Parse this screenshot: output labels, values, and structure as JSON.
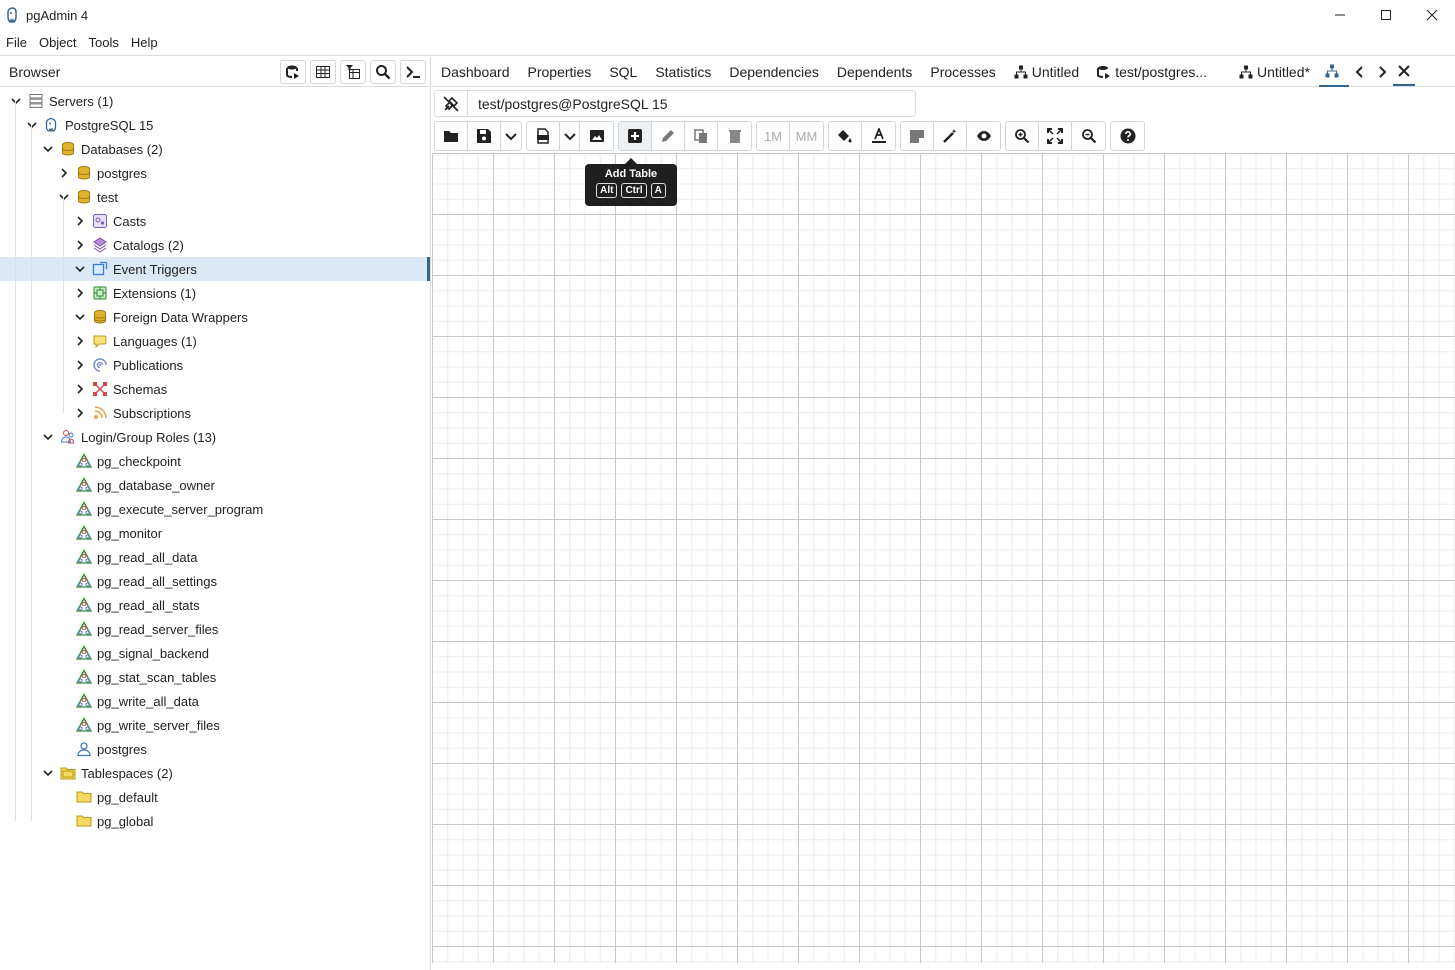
{
  "window": {
    "title": "pgAdmin 4"
  },
  "menu": [
    "File",
    "Object",
    "Tools",
    "Help"
  ],
  "browser": {
    "label": "Browser",
    "tree": [
      {
        "label": "Servers (1)",
        "level": 0,
        "chevron": "down",
        "icon": "servers-icon"
      },
      {
        "label": "PostgreSQL 15",
        "level": 1,
        "chevron": "down",
        "icon": "postgresql-icon"
      },
      {
        "label": "Databases (2)",
        "level": 2,
        "chevron": "down",
        "icon": "databases-icon"
      },
      {
        "label": "postgres",
        "level": 3,
        "chevron": "right",
        "icon": "database-icon"
      },
      {
        "label": "test",
        "level": 3,
        "chevron": "down",
        "icon": "database-icon"
      },
      {
        "label": "Casts",
        "level": 4,
        "chevron": "right",
        "icon": "casts-icon"
      },
      {
        "label": "Catalogs (2)",
        "level": 4,
        "chevron": "right",
        "icon": "catalogs-icon"
      },
      {
        "label": "Event Triggers",
        "level": 4,
        "chevron": "down",
        "icon": "event-triggers-icon",
        "selected": true
      },
      {
        "label": "Extensions (1)",
        "level": 4,
        "chevron": "right",
        "icon": "extensions-icon"
      },
      {
        "label": "Foreign Data Wrappers",
        "level": 4,
        "chevron": "down",
        "icon": "fdw-icon"
      },
      {
        "label": "Languages (1)",
        "level": 4,
        "chevron": "right",
        "icon": "languages-icon"
      },
      {
        "label": "Publications",
        "level": 4,
        "chevron": "right",
        "icon": "publications-icon"
      },
      {
        "label": "Schemas",
        "level": 4,
        "chevron": "right",
        "icon": "schemas-icon"
      },
      {
        "label": "Subscriptions",
        "level": 4,
        "chevron": "right",
        "icon": "subscriptions-icon"
      },
      {
        "label": "Login/Group Roles (13)",
        "level": 2,
        "chevron": "down",
        "icon": "roles-icon"
      },
      {
        "label": "pg_checkpoint",
        "level": 3,
        "chevron": "",
        "icon": "group-role-icon"
      },
      {
        "label": "pg_database_owner",
        "level": 3,
        "chevron": "",
        "icon": "group-role-icon"
      },
      {
        "label": "pg_execute_server_program",
        "level": 3,
        "chevron": "",
        "icon": "group-role-icon"
      },
      {
        "label": "pg_monitor",
        "level": 3,
        "chevron": "",
        "icon": "group-role-icon"
      },
      {
        "label": "pg_read_all_data",
        "level": 3,
        "chevron": "",
        "icon": "group-role-icon"
      },
      {
        "label": "pg_read_all_settings",
        "level": 3,
        "chevron": "",
        "icon": "group-role-icon"
      },
      {
        "label": "pg_read_all_stats",
        "level": 3,
        "chevron": "",
        "icon": "group-role-icon"
      },
      {
        "label": "pg_read_server_files",
        "level": 3,
        "chevron": "",
        "icon": "group-role-icon"
      },
      {
        "label": "pg_signal_backend",
        "level": 3,
        "chevron": "",
        "icon": "group-role-icon"
      },
      {
        "label": "pg_stat_scan_tables",
        "level": 3,
        "chevron": "",
        "icon": "group-role-icon"
      },
      {
        "label": "pg_write_all_data",
        "level": 3,
        "chevron": "",
        "icon": "group-role-icon"
      },
      {
        "label": "pg_write_server_files",
        "level": 3,
        "chevron": "",
        "icon": "group-role-icon"
      },
      {
        "label": "postgres",
        "level": 3,
        "chevron": "",
        "icon": "login-role-icon"
      },
      {
        "label": "Tablespaces (2)",
        "level": 2,
        "chevron": "down",
        "icon": "tablespaces-icon"
      },
      {
        "label": "pg_default",
        "level": 3,
        "chevron": "",
        "icon": "tablespace-icon"
      },
      {
        "label": "pg_global",
        "level": 3,
        "chevron": "",
        "icon": "tablespace-icon"
      }
    ]
  },
  "tabs": {
    "dashboard": "Dashboard",
    "properties": "Properties",
    "sql": "SQL",
    "statistics": "Statistics",
    "dependencies": "Dependencies",
    "dependents": "Dependents",
    "processes": "Processes",
    "untitled": "Untitled",
    "query": "test/postgres...",
    "untitled_modified": "Untitled*"
  },
  "erd": {
    "connection": "test/postgres@PostgreSQL 15",
    "one_to_many": "1M",
    "many_to_many": "MM",
    "tooltip": {
      "title": "Add Table",
      "keys": [
        "Alt",
        "Ctrl",
        "A"
      ]
    }
  },
  "colors": {
    "accent": "#326690",
    "selected_bg": "#dbe9f7",
    "icon_gold": "#d4a017"
  }
}
